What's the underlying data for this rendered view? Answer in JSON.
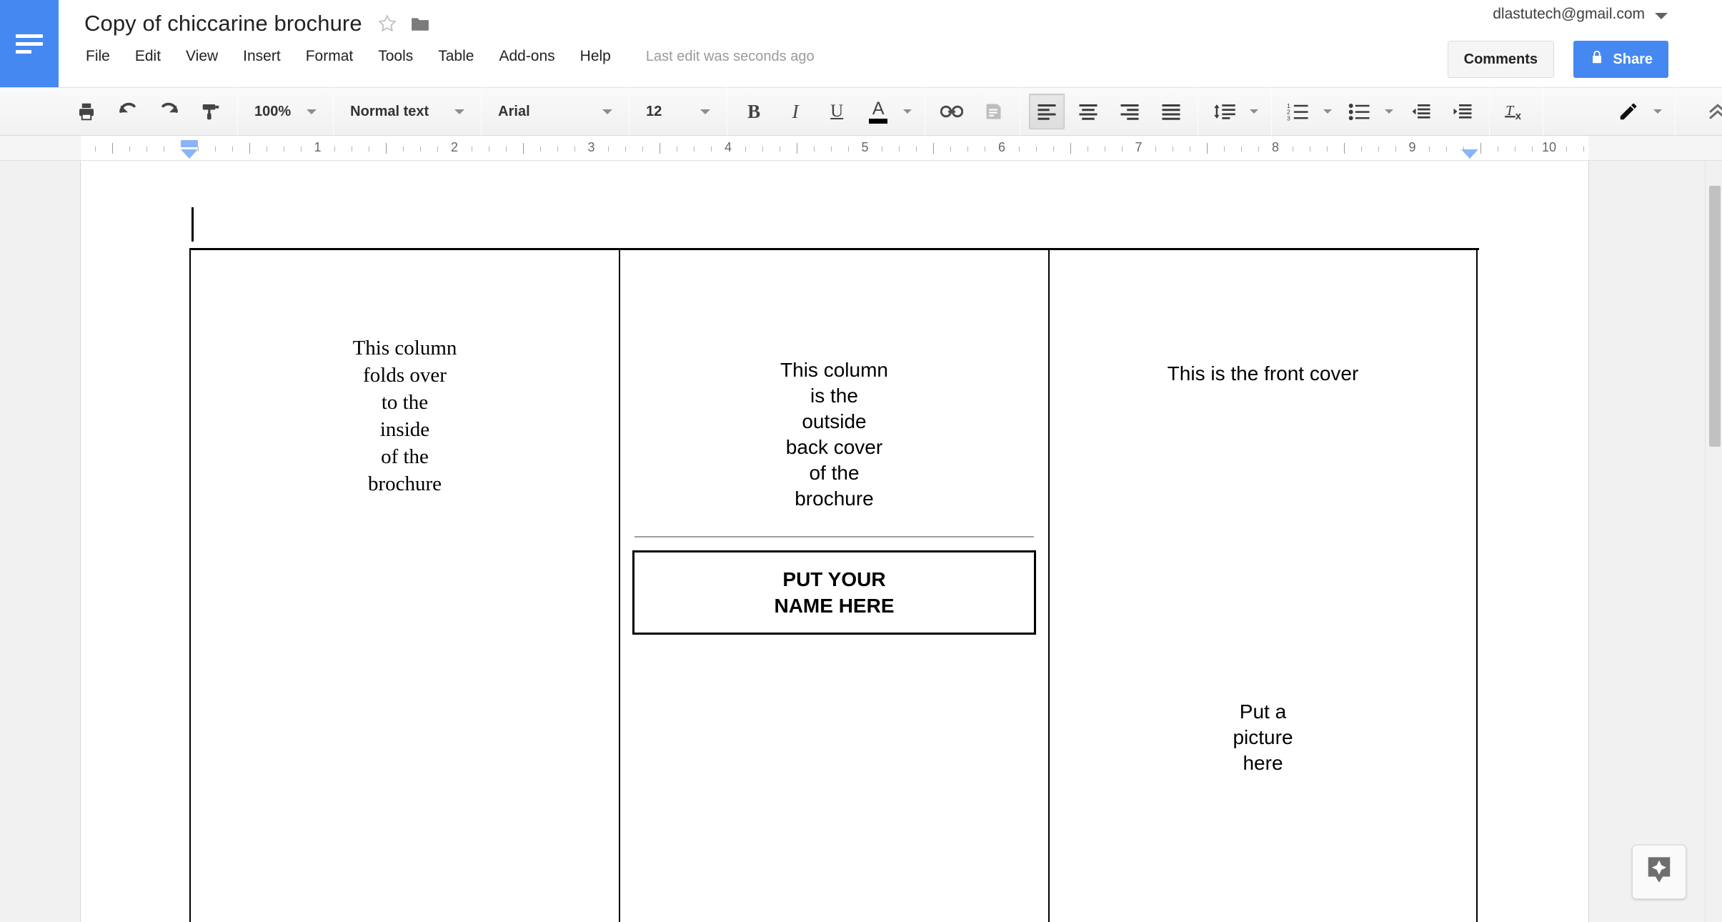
{
  "app": {
    "logo_icon": "docs-logo-icon",
    "doc_title": "Copy of chiccarine brochure",
    "star_icon": "star-outline-icon",
    "folder_icon": "folder-icon",
    "account_email": "dlastutech@gmail.com",
    "account_caret_icon": "chevron-down-icon",
    "comments_label": "Comments",
    "share_label": "Share",
    "share_lock_icon": "lock-icon"
  },
  "menubar": {
    "items": [
      {
        "label": "File"
      },
      {
        "label": "Edit"
      },
      {
        "label": "View"
      },
      {
        "label": "Insert"
      },
      {
        "label": "Format"
      },
      {
        "label": "Tools"
      },
      {
        "label": "Table"
      },
      {
        "label": "Add-ons"
      },
      {
        "label": "Help"
      }
    ],
    "last_edit": "Last edit was seconds ago"
  },
  "toolbar": {
    "print_icon": "print-icon",
    "undo_icon": "undo-icon",
    "redo_icon": "redo-icon",
    "paint_format_icon": "paint-format-icon",
    "zoom_value": "100%",
    "style_value": "Normal text",
    "font_value": "Arial",
    "font_size_value": "12",
    "bold_label": "B",
    "italic_label": "I",
    "underline_label": "U",
    "text_color_label": "A",
    "text_color_swatch": "#000000",
    "link_icon": "link-icon",
    "comment_icon": "add-comment-icon",
    "align_left_icon": "align-left-icon",
    "align_center_icon": "align-center-icon",
    "align_right_icon": "align-right-icon",
    "align_justify_icon": "align-justify-icon",
    "line_spacing_icon": "line-spacing-icon",
    "numbered_list_icon": "numbered-list-icon",
    "bulleted_list_icon": "bulleted-list-icon",
    "decrease_indent_icon": "decrease-indent-icon",
    "increase_indent_icon": "increase-indent-icon",
    "clear_formatting_icon": "clear-formatting-icon",
    "edit_mode_icon": "pencil-icon",
    "collapse_icon": "chevron-up-double-icon",
    "accent_color": "#4688f1"
  },
  "ruler": {
    "numbers": [
      "1",
      "2",
      "3",
      "4",
      "5",
      "6",
      "7",
      "8",
      "9",
      "10"
    ],
    "left_indent_marker": "indent-marker",
    "right_indent_marker": "indent-marker"
  },
  "document": {
    "columns": [
      {
        "name": "inside-fold-column",
        "font": "serif",
        "lines": [
          "This column",
          "folds over",
          "to the",
          "inside",
          "of the",
          "brochure"
        ]
      },
      {
        "name": "back-cover-column",
        "font": "sans",
        "lines": [
          "This column",
          "is the",
          "outside",
          "back cover",
          "of the",
          "brochure"
        ],
        "name_box": [
          "PUT YOUR",
          "NAME HERE"
        ]
      },
      {
        "name": "front-cover-column",
        "font": "sans",
        "heading": "This is the front cover",
        "picture_lines": [
          "Put a",
          "picture",
          "here"
        ]
      }
    ]
  },
  "explore": {
    "icon": "explore-star-icon"
  }
}
